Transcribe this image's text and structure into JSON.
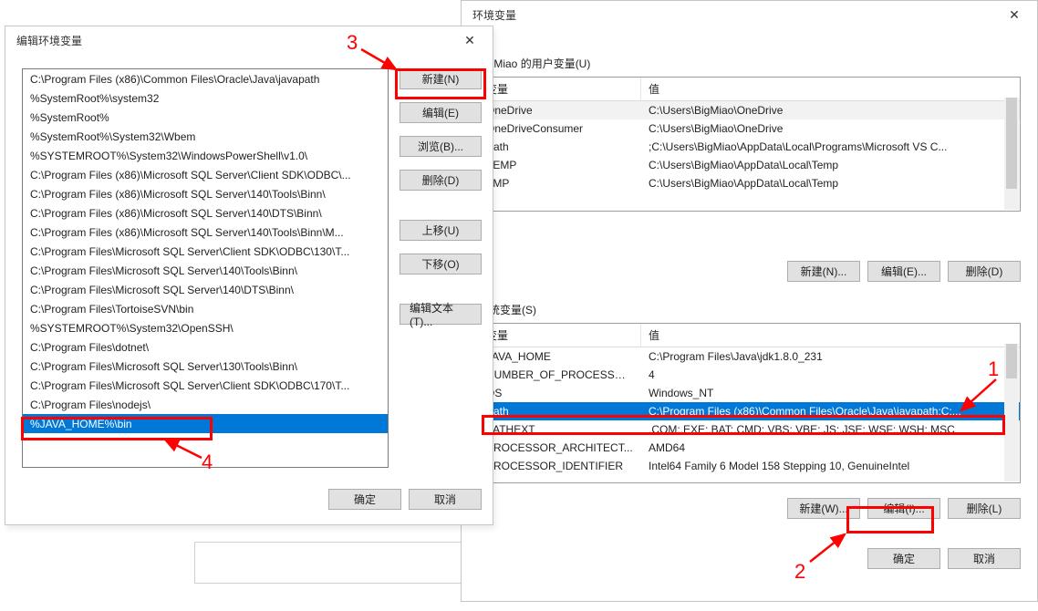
{
  "env_dialog": {
    "title": "环境变量",
    "close_icon": "✕",
    "user_section_label": "BigMiao 的用户变量(U)",
    "sys_section_label": "系统变量(S)",
    "col_var": "变量",
    "col_val": "值",
    "user_vars": [
      {
        "name": "OneDrive",
        "value": "C:\\Users\\BigMiao\\OneDrive"
      },
      {
        "name": "OneDriveConsumer",
        "value": "C:\\Users\\BigMiao\\OneDrive"
      },
      {
        "name": "Path",
        "value": ";C:\\Users\\BigMiao\\AppData\\Local\\Programs\\Microsoft VS C..."
      },
      {
        "name": "TEMP",
        "value": "C:\\Users\\BigMiao\\AppData\\Local\\Temp"
      },
      {
        "name": "TMP",
        "value": "C:\\Users\\BigMiao\\AppData\\Local\\Temp"
      }
    ],
    "sys_vars": [
      {
        "name": "JAVA_HOME",
        "value": "C:\\Program Files\\Java\\jdk1.8.0_231"
      },
      {
        "name": "NUMBER_OF_PROCESSORS",
        "value": "4"
      },
      {
        "name": "OS",
        "value": "Windows_NT"
      },
      {
        "name": "Path",
        "value": "C:\\Program Files (x86)\\Common Files\\Oracle\\Java\\javapath;C:..."
      },
      {
        "name": "PATHEXT",
        "value": ".COM;.EXE;.BAT;.CMD;.VBS;.VBE;.JS;.JSE;.WSF;.WSH;.MSC"
      },
      {
        "name": "PROCESSOR_ARCHITECT...",
        "value": "AMD64"
      },
      {
        "name": "PROCESSOR_IDENTIFIER",
        "value": "Intel64 Family 6 Model 158 Stepping 10, GenuineIntel"
      }
    ],
    "buttons": {
      "new_user": "新建(N)...",
      "edit_user": "编辑(E)...",
      "delete_user": "删除(D)",
      "new_sys": "新建(W)...",
      "edit_sys": "编辑(I)...",
      "delete_sys": "删除(L)",
      "ok": "确定",
      "cancel": "取消"
    }
  },
  "edit_dialog": {
    "title": "编辑环境变量",
    "close_icon": "✕",
    "entries": [
      "C:\\Program Files (x86)\\Common Files\\Oracle\\Java\\javapath",
      "%SystemRoot%\\system32",
      "%SystemRoot%",
      "%SystemRoot%\\System32\\Wbem",
      "%SYSTEMROOT%\\System32\\WindowsPowerShell\\v1.0\\",
      "C:\\Program Files (x86)\\Microsoft SQL Server\\Client SDK\\ODBC\\...",
      "C:\\Program Files (x86)\\Microsoft SQL Server\\140\\Tools\\Binn\\",
      "C:\\Program Files (x86)\\Microsoft SQL Server\\140\\DTS\\Binn\\",
      "C:\\Program Files (x86)\\Microsoft SQL Server\\140\\Tools\\Binn\\M...",
      "C:\\Program Files\\Microsoft SQL Server\\Client SDK\\ODBC\\130\\T...",
      "C:\\Program Files\\Microsoft SQL Server\\140\\Tools\\Binn\\",
      "C:\\Program Files\\Microsoft SQL Server\\140\\DTS\\Binn\\",
      "C:\\Program Files\\TortoiseSVN\\bin",
      "%SYSTEMROOT%\\System32\\OpenSSH\\",
      "C:\\Program Files\\dotnet\\",
      "C:\\Program Files\\Microsoft SQL Server\\130\\Tools\\Binn\\",
      "C:\\Program Files\\Microsoft SQL Server\\Client SDK\\ODBC\\170\\T...",
      "C:\\Program Files\\nodejs\\",
      "%JAVA_HOME%\\bin"
    ],
    "selected_index": 18,
    "buttons": {
      "new": "新建(N)",
      "edit": "编辑(E)",
      "browse": "浏览(B)...",
      "delete": "删除(D)",
      "move_up": "上移(U)",
      "move_down": "下移(O)",
      "edit_text": "编辑文本(T)...",
      "ok": "确定",
      "cancel": "取消"
    }
  },
  "annotations": {
    "n1": "1",
    "n2": "2",
    "n3": "3",
    "n4": "4"
  }
}
